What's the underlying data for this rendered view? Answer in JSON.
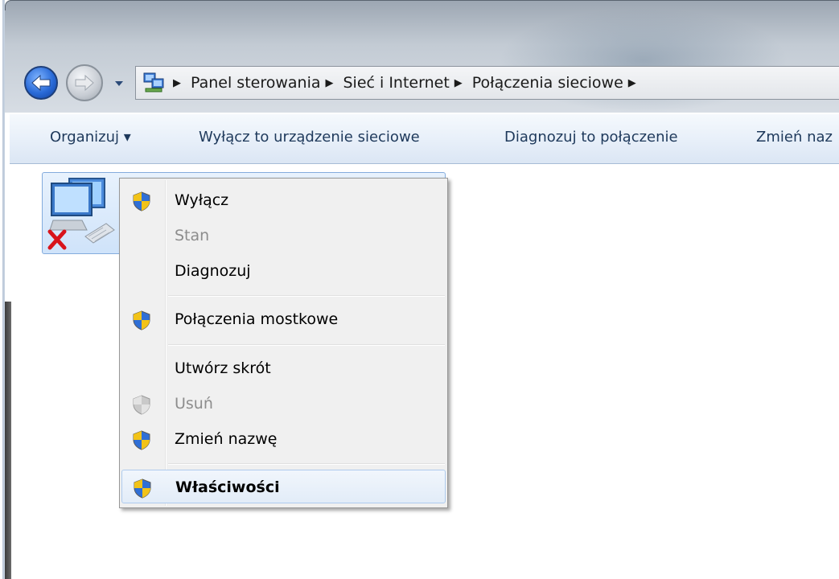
{
  "address_bar": {
    "breadcrumbs": [
      "Panel sterowania",
      "Sieć i Internet",
      "Połączenia sieciowe"
    ],
    "separator_glyph": "▶"
  },
  "command_bar": {
    "organize": "Organizuj ▾",
    "disable_device": "Wyłącz to urządzenie sieciowe",
    "diagnose_connection": "Diagnozuj to połączenie",
    "rename_partial": "Zmień naz"
  },
  "context_menu": {
    "items": [
      {
        "label": "Wyłącz",
        "icon": "uac-shield-icon",
        "enabled": true
      },
      {
        "label": "Stan",
        "icon": null,
        "enabled": false
      },
      {
        "label": "Diagnozuj",
        "icon": null,
        "enabled": true
      },
      {
        "label": "Połączenia mostkowe",
        "icon": "uac-shield-icon",
        "enabled": true
      },
      {
        "label": "Utwórz skrót",
        "icon": null,
        "enabled": true
      },
      {
        "label": "Usuń",
        "icon": "uac-shield-icon",
        "enabled": false
      },
      {
        "label": "Zmień nazwę",
        "icon": "uac-shield-icon",
        "enabled": true
      },
      {
        "label": "Właściwości",
        "icon": "uac-shield-icon",
        "enabled": true,
        "default": true,
        "highlighted": true
      }
    ]
  },
  "colors": {
    "command_text": "#1e395b",
    "menu_bg": "#f0f0f0",
    "menu_highlight_border": "#aecbee",
    "selection_border": "#84acdd",
    "disabled_text": "#8d8d8d"
  }
}
